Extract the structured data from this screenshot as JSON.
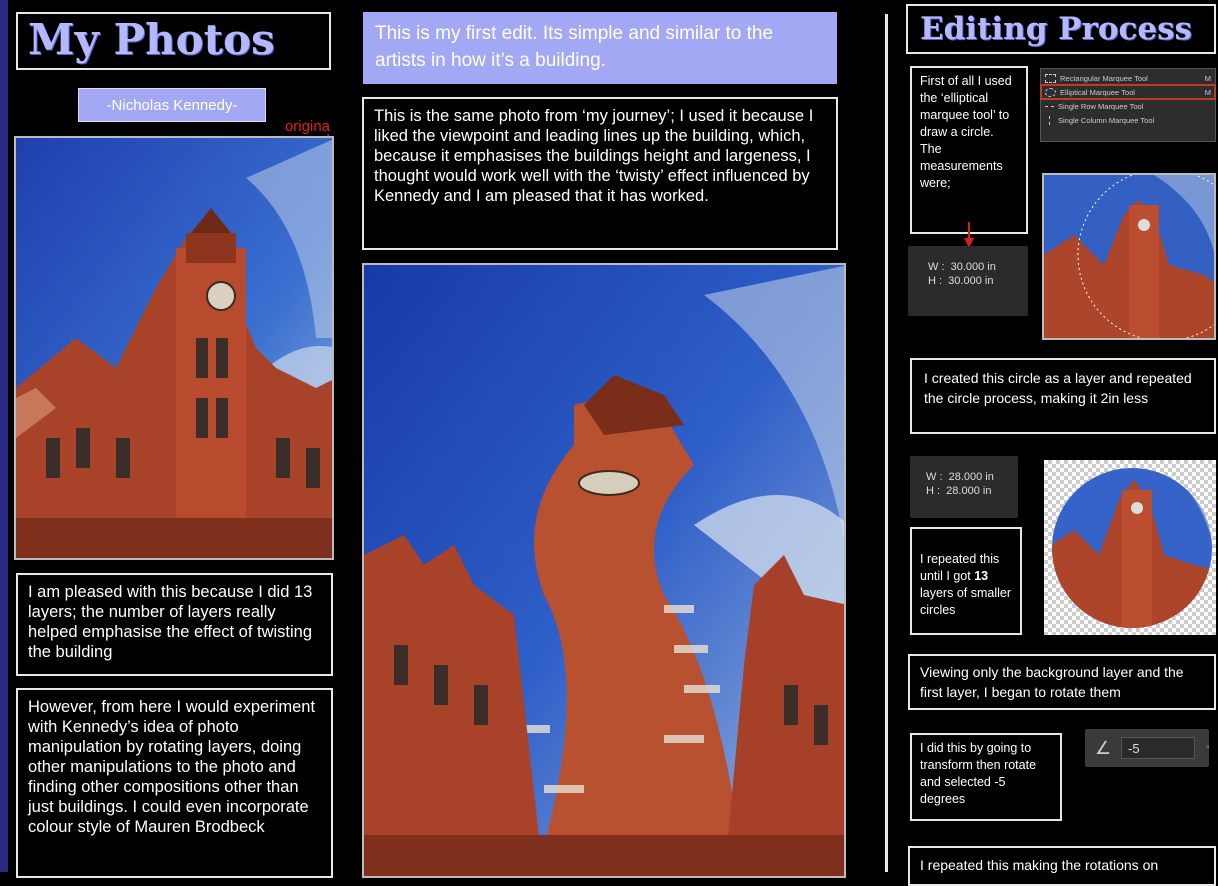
{
  "page": {
    "left_title": "My Photos",
    "artist_label": "-Nicholas Kennedy-",
    "original_label": "origina\nl",
    "left_text_1": "I am pleased with this because I did 13 layers; the number of layers really helped emphasise the effect of twisting the building",
    "left_text_2": "However, from here I would experiment with Kennedy’s idea of photo manipulation by rotating layers, doing other manipulations to the photo and finding other compositions other than just buildings. I could even incorporate colour style of Mauren Brodbeck",
    "mid_intro": "This is my first edit. Its simple and similar to the artists in how it’s a building.",
    "mid_text": "This is the same photo from ‘my journey’; I used it because I liked the viewpoint and leading lines up the building, which, because it emphasises the buildings height and largeness, I thought would work well with the ‘twisty’ effect influenced by Kennedy and I am pleased that it has worked.",
    "right_title": "Editing Process",
    "step1": "First of all I used the ‘elliptical marquee tool’ to draw a circle. The measurements were;",
    "meas1": "W :  30.000 in\nH :  30.000 in",
    "step2": "I created this circle as a layer and repeated the circle process, making it 2in less",
    "meas2": "W :  28.000 in\nH :  28.000 in",
    "step3_pre": "I repeated this  until I got ",
    "step3_bold": "13",
    "step3_post": " layers of smaller circles",
    "step4": "Viewing only the background layer and the first layer, I began to rotate them",
    "step5": "I did this by going to transform then rotate and selected -5 degrees",
    "angle_value": "-5",
    "step6": "I repeated this making the rotations on",
    "menu": {
      "items": [
        {
          "label": "Rectangular Marquee Tool",
          "key": "M"
        },
        {
          "label": "Elliptical Marquee Tool",
          "key": "M"
        },
        {
          "label": "Single Row Marquee Tool",
          "key": ""
        },
        {
          "label": "Single Column Marquee Tool",
          "key": ""
        }
      ]
    }
  }
}
